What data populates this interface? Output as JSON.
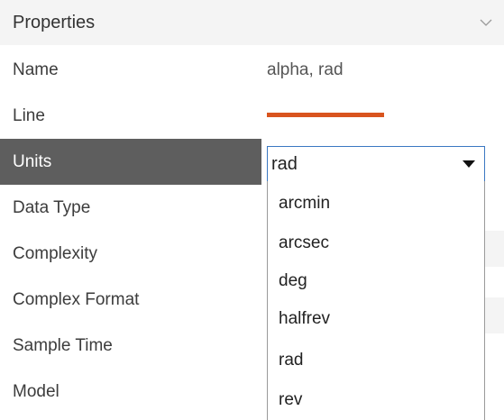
{
  "panel": {
    "title": "Properties",
    "collapse_icon": "chevron-down-icon"
  },
  "rows": [
    {
      "label": "Name",
      "value": "alpha, rad"
    },
    {
      "label": "Line",
      "line_color": "#d9541e"
    },
    {
      "label": "Units"
    },
    {
      "label": "Data Type"
    },
    {
      "label": "Complexity"
    },
    {
      "label": "Complex Format"
    },
    {
      "label": "Sample Time"
    },
    {
      "label": "Model"
    }
  ],
  "units_select": {
    "selected": "rad",
    "options": [
      "arcmin",
      "arcsec",
      "deg",
      "halfrev",
      "rad",
      "rev"
    ]
  },
  "colors": {
    "selected_row_bg": "#5e5e5e",
    "header_bg": "#f4f4f4",
    "select_border": "#3b78c2"
  }
}
